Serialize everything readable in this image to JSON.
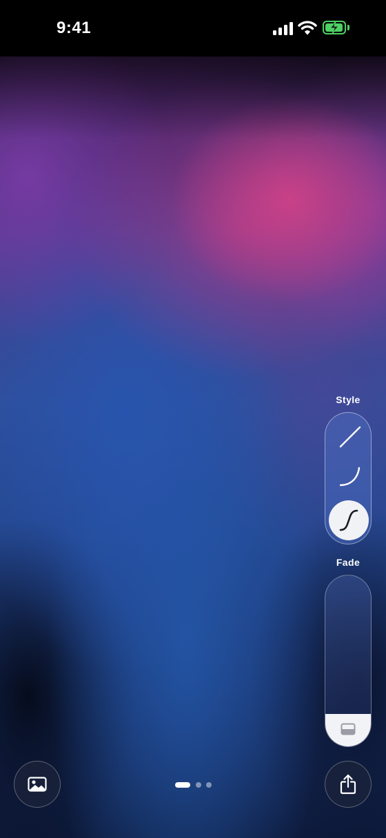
{
  "status_bar": {
    "time": "9:41",
    "battery_level": 0.95,
    "battery_color": "#4ed164"
  },
  "icons": {
    "signal": "cellular-signal-icon",
    "wifi": "wifi-icon",
    "battery": "battery-charging-icon",
    "gallery": "photo-icon",
    "share": "share-icon",
    "style_linear": "linear-curve-icon",
    "style_ease": "ease-curve-icon",
    "style_s_curve": "s-curve-icon",
    "fade_handle": "rectangle-half-icon"
  },
  "controls": {
    "style_label": "Style",
    "fade_label": "Fade",
    "style_options": [
      "linear",
      "ease",
      "s-curve"
    ],
    "selected_style": "s-curve",
    "fade_level": 0.19
  },
  "pager": {
    "page_count": 3,
    "current_page": 1
  },
  "colors": {
    "selected_style_bg": "#f1f2f6",
    "fade_fill": "#f2f3f7",
    "pink_glow": "#cd4187",
    "blue_base": "#24478f"
  }
}
